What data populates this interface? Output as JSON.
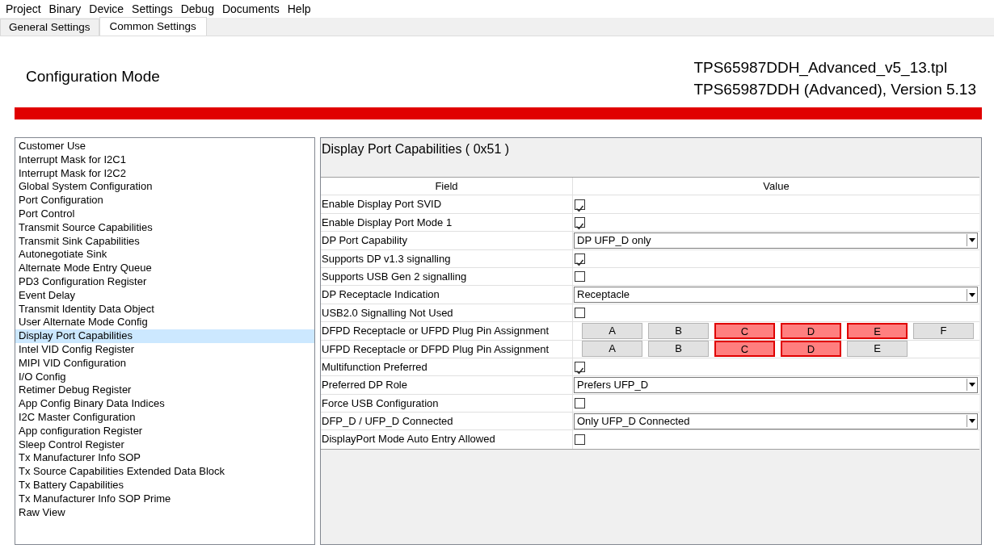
{
  "menu": [
    "Project",
    "Binary",
    "Device",
    "Settings",
    "Debug",
    "Documents",
    "Help"
  ],
  "tabs": [
    {
      "label": "General Settings",
      "selected": false
    },
    {
      "label": "Common Settings",
      "selected": true
    }
  ],
  "header": {
    "mode": "Configuration Mode",
    "file": "TPS65987DDH_Advanced_v5_13.tpl",
    "version": "TPS65987DDH (Advanced), Version 5.13"
  },
  "sidebar": {
    "items": [
      {
        "label": "Customer Use",
        "selected": false
      },
      {
        "label": "Interrupt Mask for I2C1",
        "selected": false
      },
      {
        "label": "Interrupt Mask for I2C2",
        "selected": false
      },
      {
        "label": "Global System Configuration",
        "selected": false
      },
      {
        "label": "Port Configuration",
        "selected": false
      },
      {
        "label": "Port Control",
        "selected": false
      },
      {
        "label": "Transmit Source Capabilities",
        "selected": false
      },
      {
        "label": "Transmit Sink Capabilities",
        "selected": false
      },
      {
        "label": "Autonegotiate Sink",
        "selected": false
      },
      {
        "label": "Alternate Mode Entry Queue",
        "selected": false
      },
      {
        "label": "PD3 Configuration Register",
        "selected": false
      },
      {
        "label": "Event Delay",
        "selected": false
      },
      {
        "label": "Transmit Identity Data Object",
        "selected": false
      },
      {
        "label": "User Alternate Mode Config",
        "selected": false
      },
      {
        "label": "Display Port Capabilities",
        "selected": true
      },
      {
        "label": "Intel VID Config Register",
        "selected": false
      },
      {
        "label": "MIPI VID Configuration",
        "selected": false
      },
      {
        "label": "I/O Config",
        "selected": false
      },
      {
        "label": "Retimer Debug Register",
        "selected": false
      },
      {
        "label": "App Config Binary Data Indices",
        "selected": false
      },
      {
        "label": "I2C Master Configuration",
        "selected": false
      },
      {
        "label": "App configuration Register",
        "selected": false
      },
      {
        "label": "Sleep Control Register",
        "selected": false
      },
      {
        "label": "Tx Manufacturer Info SOP",
        "selected": false
      },
      {
        "label": "Tx Source Capabilities Extended Data Block",
        "selected": false
      },
      {
        "label": "Tx Battery Capabilities",
        "selected": false
      },
      {
        "label": "Tx Manufacturer Info SOP Prime",
        "selected": false
      },
      {
        "label": "Raw View",
        "selected": false
      }
    ]
  },
  "panel": {
    "title": "Display Port Capabilities  ( 0x51 )",
    "table": {
      "columns": [
        "Field",
        "Value"
      ],
      "rows": [
        {
          "field": "Enable Display Port SVID",
          "kind": "checkbox",
          "checked": true
        },
        {
          "field": "Enable Display Port Mode 1",
          "kind": "checkbox",
          "checked": true
        },
        {
          "field": "DP Port Capability",
          "kind": "select",
          "value": "DP UFP_D only"
        },
        {
          "field": "Supports DP v1.3 signalling",
          "kind": "checkbox",
          "checked": true
        },
        {
          "field": "Supports USB Gen 2 signalling",
          "kind": "checkbox",
          "checked": false
        },
        {
          "field": "DP Receptacle Indication",
          "kind": "select",
          "value": "Receptacle"
        },
        {
          "field": "USB2.0 Signalling Not Used",
          "kind": "checkbox",
          "checked": false
        },
        {
          "field": "DFPD Receptacle or UFPD Plug Pin Assignment",
          "kind": "pins",
          "pins": [
            {
              "label": "A",
              "selected": false
            },
            {
              "label": "B",
              "selected": false
            },
            {
              "label": "C",
              "selected": true
            },
            {
              "label": "D",
              "selected": true
            },
            {
              "label": "E",
              "selected": true
            },
            {
              "label": "F",
              "selected": false
            }
          ]
        },
        {
          "field": "UFPD Receptacle or DFPD Plug Pin Assignment",
          "kind": "pins",
          "pins": [
            {
              "label": "A",
              "selected": false
            },
            {
              "label": "B",
              "selected": false
            },
            {
              "label": "C",
              "selected": true
            },
            {
              "label": "D",
              "selected": true
            },
            {
              "label": "E",
              "selected": false
            }
          ]
        },
        {
          "field": "Multifunction Preferred",
          "kind": "checkbox",
          "checked": true
        },
        {
          "field": "Preferred DP Role",
          "kind": "select",
          "value": "Prefers UFP_D"
        },
        {
          "field": "Force USB Configuration",
          "kind": "checkbox",
          "checked": false
        },
        {
          "field": "DFP_D / UFP_D Connected",
          "kind": "select",
          "value": "Only UFP_D Connected"
        },
        {
          "field": "DisplayPort Mode Auto Entry Allowed",
          "kind": "checkbox",
          "checked": false
        }
      ]
    }
  }
}
